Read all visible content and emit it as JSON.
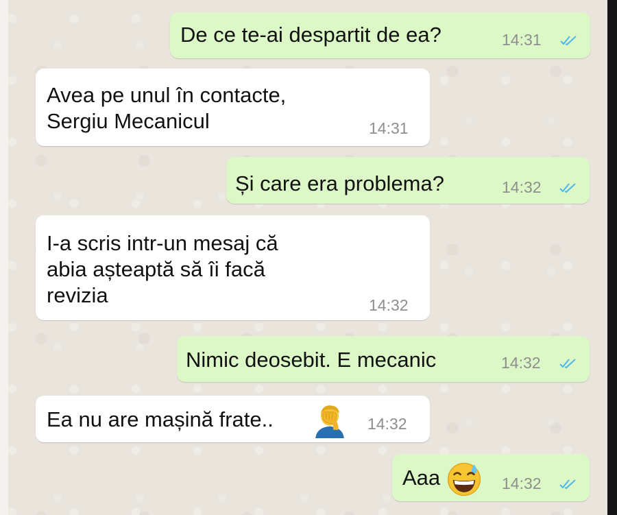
{
  "colors": {
    "outgoing_bubble": "#dcf8c6",
    "incoming_bubble": "#ffffff",
    "timestamp": "#8e8e8e",
    "read_ticks": "#4fb6ec"
  },
  "messages": [
    {
      "direction": "outgoing",
      "text": "De ce te-ai despartit de ea?",
      "time": "14:31",
      "status": "read-ticks-icon"
    },
    {
      "direction": "incoming",
      "text": "Avea pe unul în contacte,\nSergiu Mecanicul",
      "time": "14:31"
    },
    {
      "direction": "outgoing",
      "text": "Și care era problema?",
      "time": "14:32",
      "status": "read-ticks-icon"
    },
    {
      "direction": "incoming",
      "text": "I-a scris intr-un mesaj că\nabia așteaptă să îi facă\nrevizia",
      "time": "14:32"
    },
    {
      "direction": "outgoing",
      "text": "Nimic deosebit. E mecanic",
      "time": "14:32",
      "status": "read-ticks-icon"
    },
    {
      "direction": "incoming",
      "text": "Ea nu are mașină frate..",
      "emoji": "facepalm-emoji",
      "time": "14:32"
    },
    {
      "direction": "outgoing",
      "text": "Aaa",
      "emoji": "grinning-sweat-emoji",
      "time": "14:32",
      "status": "read-ticks-icon"
    }
  ]
}
